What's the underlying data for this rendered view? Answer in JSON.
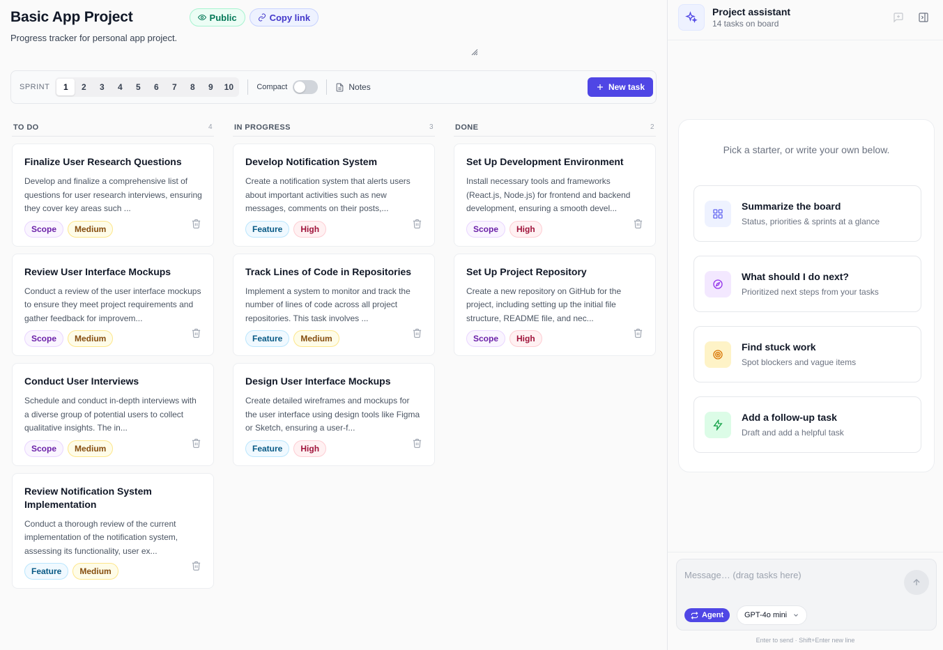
{
  "project": {
    "title": "Basic App Project",
    "description": "Progress tracker for personal app project.",
    "public_label": "Public",
    "copy_link_label": "Copy link"
  },
  "toolbar": {
    "sprint_label": "SPRINT",
    "sprints": [
      "1",
      "2",
      "3",
      "4",
      "5",
      "6",
      "7",
      "8",
      "9",
      "10"
    ],
    "active_sprint": "1",
    "compact_label": "Compact",
    "compact_on": false,
    "notes_label": "Notes",
    "new_task_label": "New task"
  },
  "columns": [
    {
      "name": "TO DO",
      "count": "4",
      "cards": [
        {
          "title": "Finalize User Research Questions",
          "desc": "Develop and finalize a comprehensive list of questions for user research interviews, ensuring they cover key areas such ...",
          "type": "Scope",
          "priority": "Medium"
        },
        {
          "title": "Review User Interface Mockups",
          "desc": "Conduct a review of the user interface mockups to ensure they meet project requirements and gather feedback for improvem...",
          "type": "Scope",
          "priority": "Medium"
        },
        {
          "title": "Conduct User Interviews",
          "desc": "Schedule and conduct in-depth interviews with a diverse group of potential users to collect qualitative insights. The in...",
          "type": "Scope",
          "priority": "Medium"
        },
        {
          "title": "Review Notification System Implementation",
          "desc": "Conduct a thorough review of the current implementation of the notification system, assessing its functionality, user ex...",
          "type": "Feature",
          "priority": "Medium"
        }
      ]
    },
    {
      "name": "IN PROGRESS",
      "count": "3",
      "cards": [
        {
          "title": "Develop Notification System",
          "desc": "Create a notification system that alerts users about important activities such as new messages, comments on their posts,...",
          "type": "Feature",
          "priority": "High"
        },
        {
          "title": "Track Lines of Code in Repositories",
          "desc": "Implement a system to monitor and track the number of lines of code across all project repositories. This task involves ...",
          "type": "Feature",
          "priority": "Medium"
        },
        {
          "title": "Design User Interface Mockups",
          "desc": "Create detailed wireframes and mockups for the user interface using design tools like Figma or Sketch, ensuring a user-f...",
          "type": "Feature",
          "priority": "High"
        }
      ]
    },
    {
      "name": "DONE",
      "count": "2",
      "cards": [
        {
          "title": "Set Up Development Environment",
          "desc": "Install necessary tools and frameworks (React.js, Node.js) for frontend and backend development, ensuring a smooth devel...",
          "type": "Scope",
          "priority": "High"
        },
        {
          "title": "Set Up Project Repository",
          "desc": "Create a new repository on GitHub for the project, including setting up the initial file structure, README file, and nec...",
          "type": "Scope",
          "priority": "High"
        }
      ]
    }
  ],
  "assistant": {
    "title": "Project assistant",
    "subtitle": "14 tasks on board",
    "prompt": "Pick a starter, or write your own below.",
    "starters": [
      {
        "title": "Summarize the board",
        "subtitle": "Status, priorities & sprints at a glance",
        "icon": "grid-icon",
        "color": "#eef2ff",
        "stroke": "#6366f1"
      },
      {
        "title": "What should I do next?",
        "subtitle": "Prioritized next steps from your tasks",
        "icon": "compass-icon",
        "color": "#f3e8ff",
        "stroke": "#9333ea"
      },
      {
        "title": "Find stuck work",
        "subtitle": "Spot blockers and vague items",
        "icon": "target-icon",
        "color": "#fef3c7",
        "stroke": "#d97706"
      },
      {
        "title": "Add a follow-up task",
        "subtitle": "Draft and add a helpful task",
        "icon": "bolt-icon",
        "color": "#dcfce7",
        "stroke": "#16a34a"
      }
    ],
    "composer_placeholder": "Message… (drag tasks here)",
    "agent_label": "Agent",
    "model_label": "GPT-4o mini",
    "hint": "Enter to send · Shift+Enter new line"
  }
}
